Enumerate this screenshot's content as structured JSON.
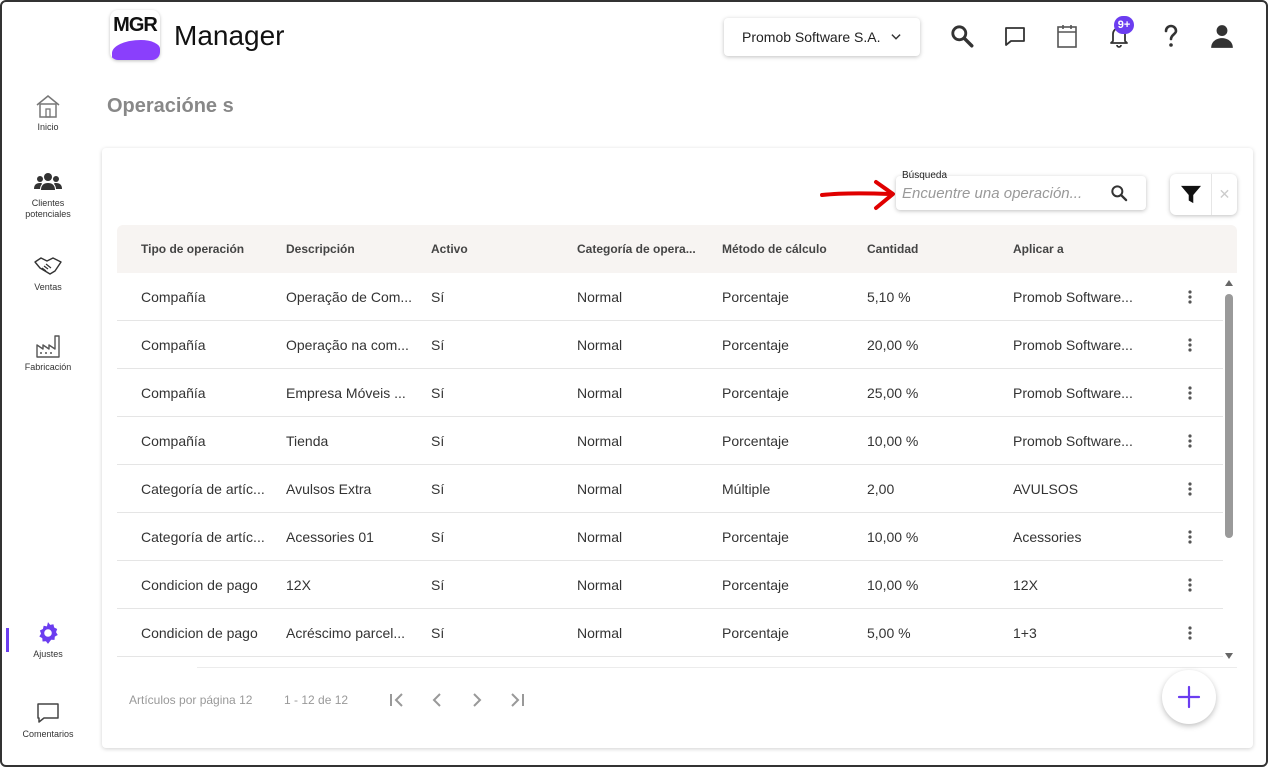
{
  "app": {
    "logo_text": "MGR",
    "title": "Manager"
  },
  "header": {
    "company": "Promob Software S.A.",
    "notification_badge": "9+",
    "icons": [
      "search-icon",
      "chat-icon",
      "calendar-icon",
      "bell-icon",
      "help-icon",
      "user-icon"
    ]
  },
  "sidebar": {
    "items": [
      {
        "label": "Inicio",
        "icon": "home-icon"
      },
      {
        "label": "Clientes potenciales",
        "icon": "people-icon"
      },
      {
        "label": "Ventas",
        "icon": "handshake-icon"
      },
      {
        "label": "Fabricación",
        "icon": "factory-icon"
      },
      {
        "label": "Ajustes",
        "icon": "gear-icon",
        "active": true
      },
      {
        "label": "Comentarios",
        "icon": "comment-icon"
      }
    ]
  },
  "page": {
    "title": "Operacióne s"
  },
  "search": {
    "label": "Búsqueda",
    "placeholder": "Encuentre una operación..."
  },
  "table": {
    "columns": [
      "Tipo de operación",
      "Descripción",
      "Activo",
      "Categoría de opera...",
      "Método de cálculo",
      "Cantidad",
      "Aplicar a"
    ],
    "rows": [
      [
        "Compañía",
        "Operação de Com...",
        "Sí",
        "Normal",
        "Porcentaje",
        "5,10 %",
        "Promob Software..."
      ],
      [
        "Compañía",
        "Operação na com...",
        "Sí",
        "Normal",
        "Porcentaje",
        "20,00 %",
        "Promob Software..."
      ],
      [
        "Compañía",
        "Empresa Móveis ...",
        "Sí",
        "Normal",
        "Porcentaje",
        "25,00 %",
        "Promob Software..."
      ],
      [
        "Compañía",
        "Tienda",
        "Sí",
        "Normal",
        "Porcentaje",
        "10,00 %",
        "Promob Software..."
      ],
      [
        "Categoría de artíc...",
        "Avulsos Extra",
        "Sí",
        "Normal",
        "Múltiple",
        "2,00",
        "AVULSOS"
      ],
      [
        "Categoría de artíc...",
        "Acessories 01",
        "Sí",
        "Normal",
        "Porcentaje",
        "10,00 %",
        "Acessories"
      ],
      [
        "Condicion de pago",
        "12X",
        "Sí",
        "Normal",
        "Porcentaje",
        "10,00 %",
        "12X"
      ],
      [
        "Condicion de pago",
        "Acréscimo parcel...",
        "Sí",
        "Normal",
        "Porcentaje",
        "5,00 %",
        "1+3"
      ]
    ]
  },
  "pagination": {
    "per_page_label": "Artículos por página 12",
    "range": "1 - 12 de 12"
  },
  "colors": {
    "accent": "#6b3df0",
    "logo": "#8a3ffc",
    "arrow": "#e00000"
  }
}
